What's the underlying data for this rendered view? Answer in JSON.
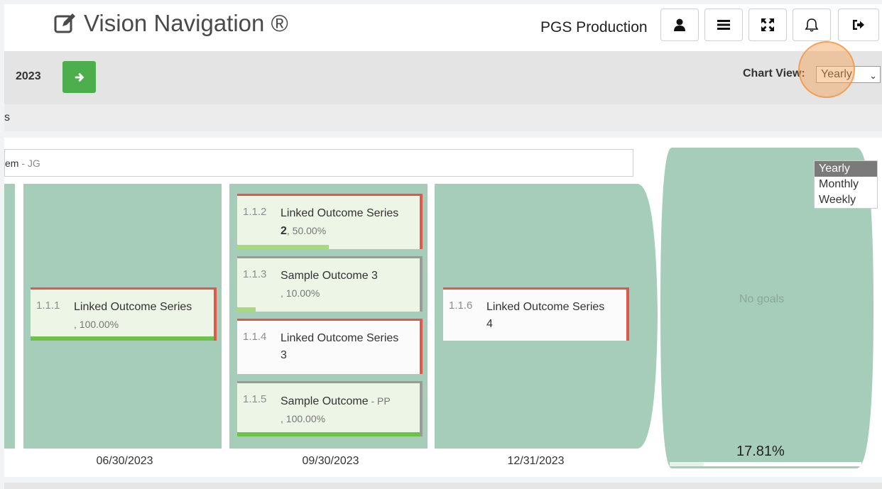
{
  "header": {
    "brand": "Vision Navigation ®",
    "org_name": "PGS Production"
  },
  "toolbar": {
    "year": "2023",
    "chart_view_label": "Chart View:",
    "chart_view_value": "Yearly"
  },
  "subbar": {
    "label": "s"
  },
  "owner": {
    "text": "em",
    "suffix": " - JG"
  },
  "dropdown": {
    "options": [
      "Yearly",
      "Monthly",
      "Weekly"
    ]
  },
  "columns": [
    {
      "date": "06/30/2023",
      "cards": [
        {
          "num": "1.1.1",
          "title": "Linked Outcome Series",
          "pct": ", 100.00%",
          "progress": 1.0
        }
      ]
    },
    {
      "date": "09/30/2023",
      "cards": [
        {
          "num": "1.1.2",
          "title": "Linked Outcome Series",
          "title_bold": "2",
          "pct": ", 50.00%",
          "progress": 0.5
        },
        {
          "num": "1.1.3",
          "title": "Sample Outcome 3",
          "pct": ", 10.00%",
          "progress": 0.1
        },
        {
          "num": "1.1.4",
          "title": "Linked Outcome Series",
          "line2": "3"
        },
        {
          "num": "1.1.5",
          "title": "Sample Outcome",
          "owner": " - PP",
          "pct": ", 100.00%",
          "progress": 1.0
        }
      ]
    },
    {
      "date": "12/31/2023",
      "cards": [
        {
          "num": "1.1.6",
          "title": "Linked Outcome Series",
          "line2": "4"
        }
      ]
    }
  ],
  "summary": {
    "no_goals": "No goals",
    "total_pct": "17.81%"
  }
}
